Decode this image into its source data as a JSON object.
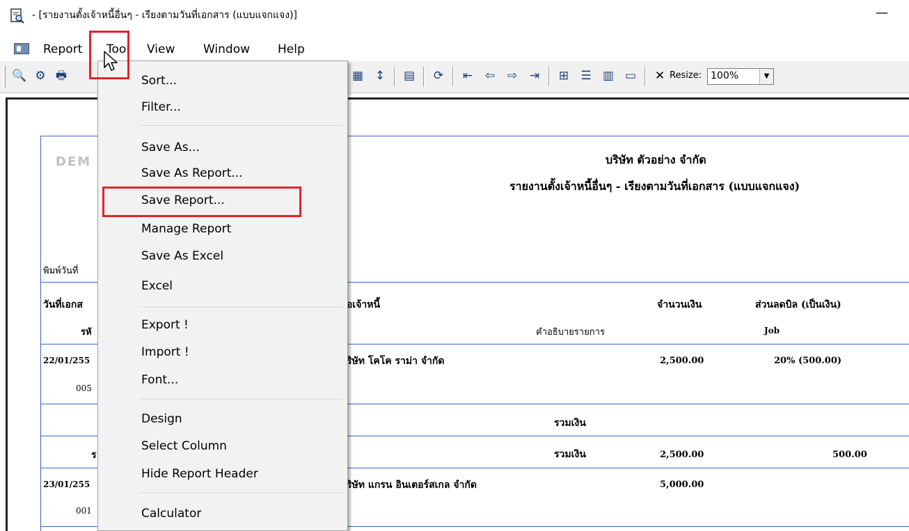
{
  "window": {
    "title": "- [รายงานตั้งเจ้าหนี้อื่นๆ - เรียงตามวันที่เอกสาร (แบบแจกแจง)]",
    "minimize_glyph": "—"
  },
  "menubar": {
    "items": [
      "Report",
      "Tool",
      "View",
      "Window",
      "Help"
    ]
  },
  "toolbar": {
    "resize_label": "Resize:",
    "resize_value": "100%",
    "close_glyph": "✕"
  },
  "tool_menu": {
    "items": [
      "Sort...",
      "Filter...",
      "Save As...",
      "Save As Report...",
      "Save Report...",
      "Manage Report",
      "Save As Excel",
      "Excel",
      "Export !",
      "Import !",
      "Font...",
      "Design",
      "Select Column",
      "Hide Report Header",
      "Calculator"
    ],
    "highlighted": "Save Report..."
  },
  "report": {
    "watermark": "DEM",
    "company": "บริษัท ตัวอย่าง จำกัด",
    "title": "รายงานตั้งเจ้าหนี้อื่นๆ - เรียงตามวันที่เอกสาร (แบบแจกแจง)",
    "print_date_label": "พิมพ์วันที่",
    "headers": {
      "doc_date": "วันที่เอกส",
      "creditor": "อเจ้าหนี้",
      "amount": "จำนวนเงิน",
      "discount": "ส่วนลดบิล (เป็นเงิน)",
      "code": "รหั",
      "description": "คำอธิบายรายการ",
      "job": "Job"
    },
    "rows": [
      {
        "date": "22/01/255",
        "creditor": "ริษัท โคโค ราม่า จำกัด",
        "amount": "2,500.00",
        "discount": "20% (500.00)",
        "code": "005"
      },
      {
        "date": "23/01/255",
        "creditor": "ริษัท แกรน อินเตอร์สเกล จำกัด",
        "amount": "5,000.00",
        "code": "001"
      }
    ],
    "subtotal_label": "รวมเงิน",
    "total_prefix": "ร",
    "total_label": "รวมเงิน",
    "total_amount": "2,500.00",
    "total_discount": "500.00"
  }
}
